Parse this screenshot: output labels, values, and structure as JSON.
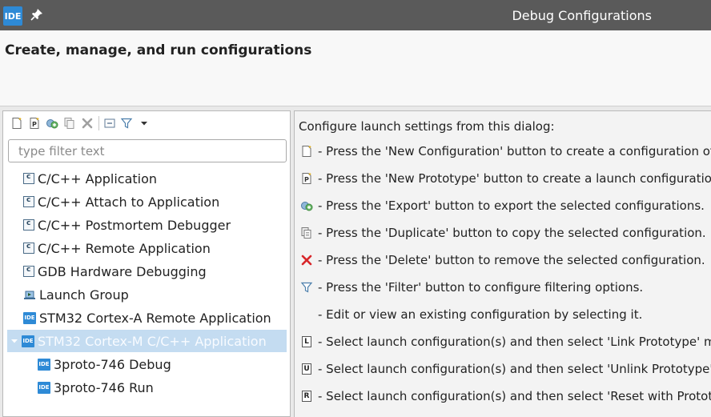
{
  "window": {
    "app_icon_label": "IDE",
    "title": "Debug Configurations"
  },
  "header": {
    "title": "Create, manage, and run configurations"
  },
  "left": {
    "filter_placeholder": "type filter text",
    "tree": [
      {
        "label": "C/C++ Application",
        "icon": "c-config-icon"
      },
      {
        "label": "C/C++ Attach to Application",
        "icon": "c-config-icon"
      },
      {
        "label": "C/C++ Postmortem Debugger",
        "icon": "c-config-icon"
      },
      {
        "label": "C/C++ Remote Application",
        "icon": "c-config-icon"
      },
      {
        "label": "GDB Hardware Debugging",
        "icon": "c-config-icon"
      },
      {
        "label": "Launch Group",
        "icon": "launch-group-icon"
      },
      {
        "label": "STM32 Cortex-A Remote Application",
        "icon": "ide-icon"
      },
      {
        "label": "STM32 Cortex-M C/C++ Application",
        "icon": "ide-icon",
        "selected": true,
        "expanded": true
      },
      {
        "label": "3proto-746 Debug",
        "icon": "ide-icon"
      },
      {
        "label": "3proto-746 Run",
        "icon": "ide-icon"
      }
    ],
    "ide_badge": "IDE"
  },
  "right": {
    "intro": "Configure launch settings from this dialog:",
    "lines": [
      {
        "text": "- Press the 'New Configuration' button to create a configuration of the selected type.",
        "icon": "new-config-icon"
      },
      {
        "text": "- Press the 'New Prototype' button to create a launch configuration prototype of the selected type.",
        "icon": "new-prototype-icon"
      },
      {
        "text": "- Press the 'Export' button to export the selected configurations.",
        "icon": "export-icon"
      },
      {
        "text": "- Press the 'Duplicate' button to copy the selected configuration.",
        "icon": "duplicate-icon"
      },
      {
        "text": "- Press the 'Delete' button to remove the selected configuration.",
        "icon": "delete-icon"
      },
      {
        "text": "- Press the 'Filter' button to configure filtering options.",
        "icon": "filter-icon"
      },
      {
        "text": "- Edit or view an existing configuration by selecting it.",
        "icon": ""
      },
      {
        "text": "- Select launch configuration(s) and then select 'Link Prototype' menu action to link a prototype.",
        "icon": "link-prototype-icon",
        "letter": "L"
      },
      {
        "text": "- Select launch configuration(s) and then select 'Unlink Prototype' menu action to unlink a prototype.",
        "icon": "unlink-prototype-icon",
        "letter": "U"
      },
      {
        "text": "- Select launch configuration(s) and then select 'Reset with Prototype values' menu action.",
        "icon": "reset-prototype-icon",
        "letter": "R"
      }
    ]
  },
  "colors": {
    "titlebar": "#5a5a5a",
    "selection": "#c4dcf1",
    "ide_blue": "#2e8ad6",
    "delete_red": "#d8262a"
  }
}
